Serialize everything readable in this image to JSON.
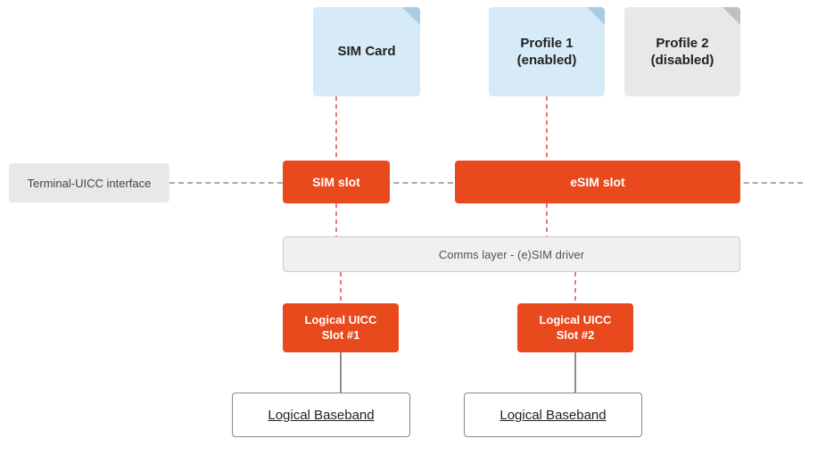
{
  "cards": {
    "sim_card": {
      "label": "SIM\nCard"
    },
    "profile1": {
      "label": "Profile 1\n(enabled)"
    },
    "profile2": {
      "label": "Profile 2\n(disabled)"
    }
  },
  "interface": {
    "terminal_label": "Terminal-UICC interface"
  },
  "slots": {
    "sim_slot": "SIM slot",
    "esim_slot": "eSIM slot"
  },
  "comms_layer": {
    "label": "Comms layer - (e)SIM driver"
  },
  "logical_uicc": {
    "slot1": "Logical UICC\nSlot #1",
    "slot2": "Logical UICC\nSlot #2"
  },
  "baseband": {
    "label1": "Logical  Baseband",
    "label2": "Logical Baseband"
  },
  "colors": {
    "orange": "#e8491d",
    "light_blue": "#d6eaf8",
    "light_gray": "#e8e8e8",
    "dashed_line": "#aaa",
    "red_dashed": "#e05050"
  }
}
